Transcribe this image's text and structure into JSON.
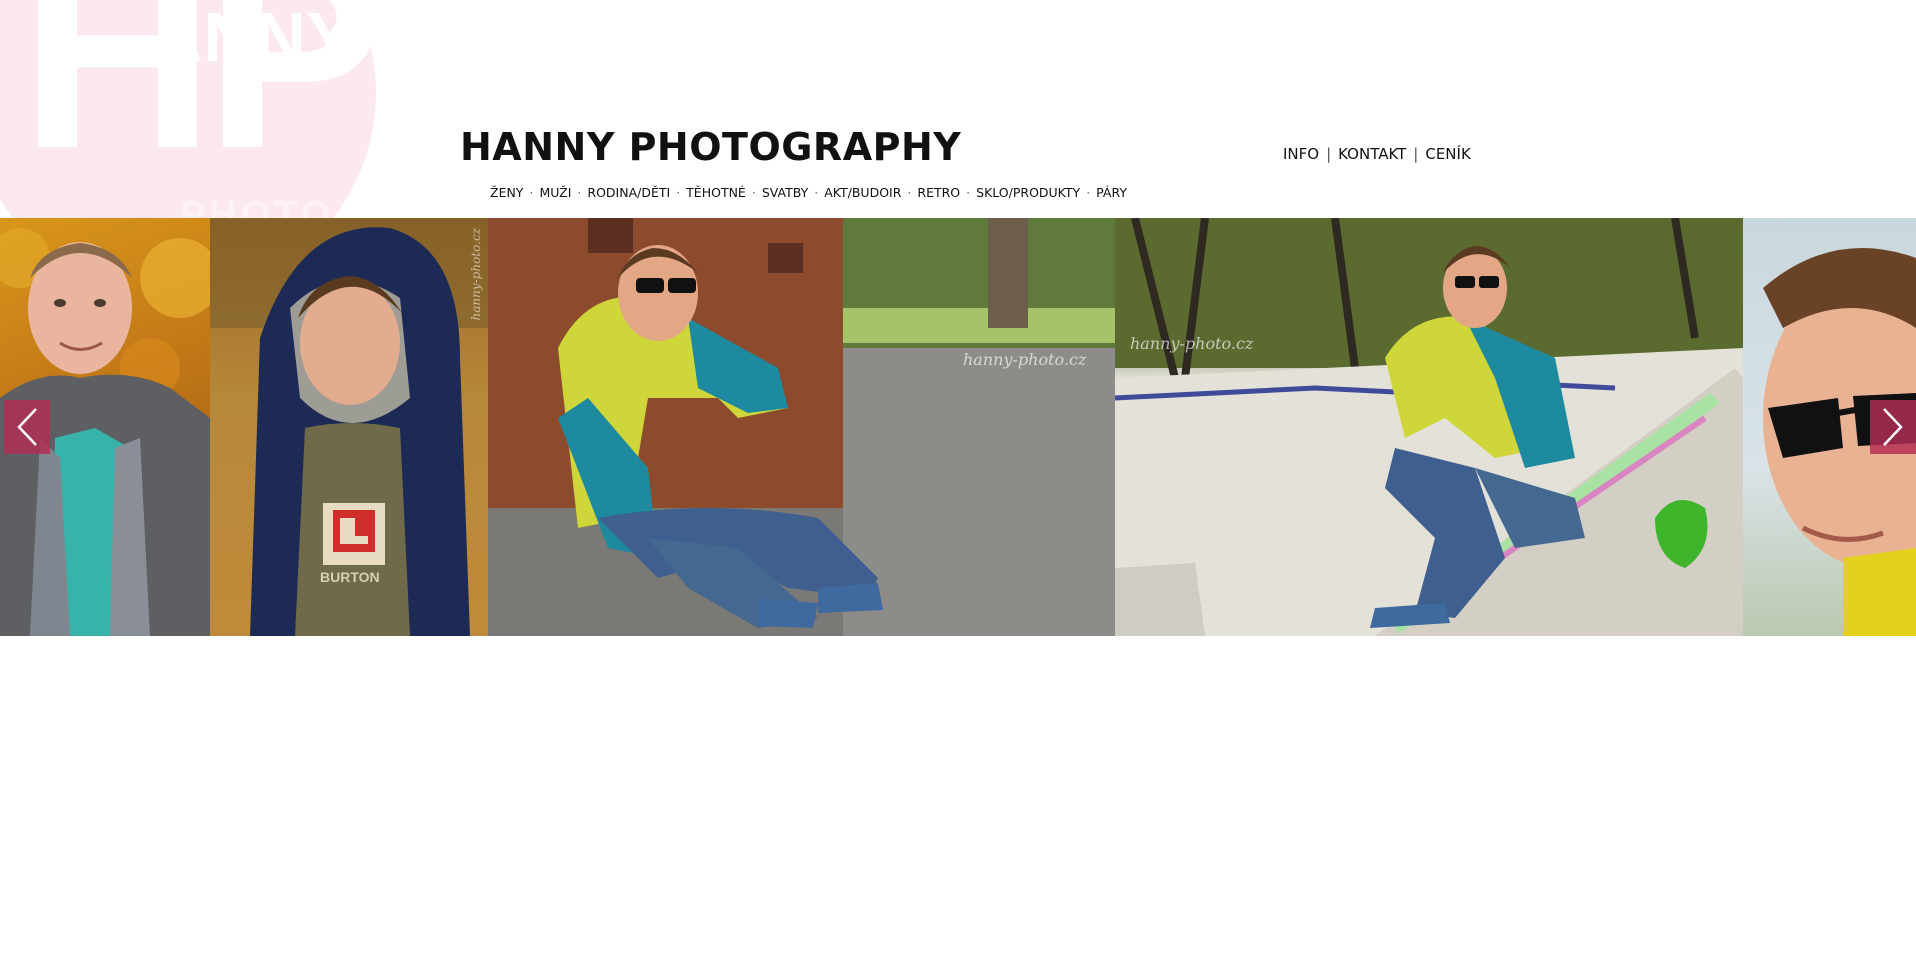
{
  "brand": {
    "logo_letters": "HP",
    "logo_word": "ANNY",
    "logo_sub": "PHOTO"
  },
  "header": {
    "title": "HANNY PHOTOGRAPHY"
  },
  "top_links": [
    {
      "label": "INFO"
    },
    {
      "label": "KONTAKT"
    },
    {
      "label": "CENÍK"
    }
  ],
  "nav": [
    {
      "label": "ŽENY"
    },
    {
      "label": "MUŽI"
    },
    {
      "label": "RODINA/DĚTI"
    },
    {
      "label": "TĚHOTNÉ"
    },
    {
      "label": "SVATBY"
    },
    {
      "label": "AKT/BUDOIR"
    },
    {
      "label": "RETRO"
    },
    {
      "label": "SKLO/PRODUKTY"
    },
    {
      "label": "PÁRY"
    }
  ],
  "slider": {
    "watermark": "hanny-photo.cz",
    "shirt_brand": "BURTON",
    "prev_icon": "chevron-left-icon",
    "next_icon": "chevron-right-icon",
    "accent_color": "#b22c54"
  }
}
